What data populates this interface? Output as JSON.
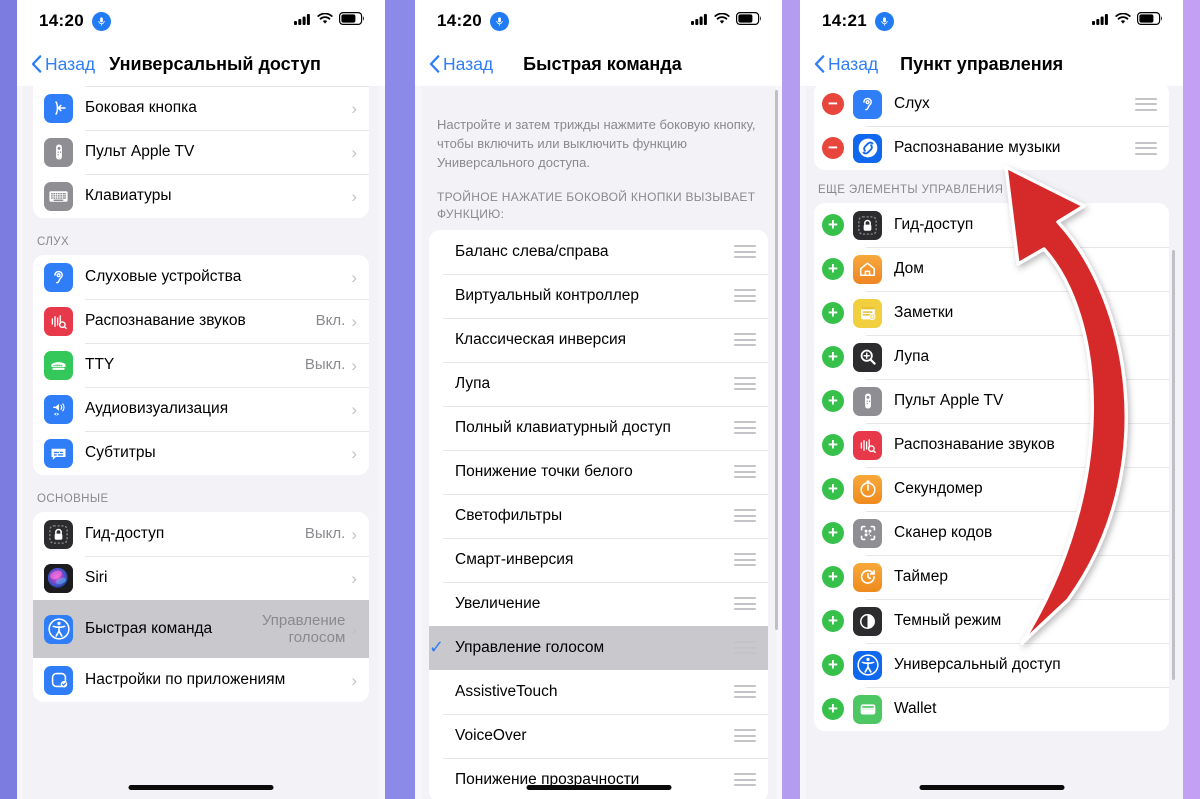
{
  "panel1": {
    "status": {
      "time": "14:20",
      "mic_icon": "microphone-icon",
      "signal_icon": "cellular-signal-icon",
      "wifi_icon": "wifi-icon",
      "battery_icon": "battery-icon"
    },
    "nav": {
      "back_label": "Назад",
      "title": "Универсальный доступ"
    },
    "sections": [
      {
        "header": "",
        "rows": [
          {
            "label": "Боковая кнопка",
            "value": "",
            "chevron": true,
            "icon": "side-button-icon",
            "icon_color": "#2f7ef7"
          },
          {
            "label": "Пульт Apple TV",
            "value": "",
            "chevron": true,
            "icon": "apple-tv-remote-icon",
            "icon_color": "#8e8e93"
          },
          {
            "label": "Клавиатуры",
            "value": "",
            "chevron": true,
            "icon": "keyboard-icon",
            "icon_color": "#8e8e93"
          }
        ]
      },
      {
        "header": "СЛУХ",
        "rows": [
          {
            "label": "Слуховые устройства",
            "value": "",
            "chevron": true,
            "icon": "ear-icon",
            "icon_color": "#2f7ef7"
          },
          {
            "label": "Распознавание звуков",
            "value": "Вкл.",
            "chevron": true,
            "icon": "sound-recognition-icon",
            "icon_color": "#e8394a"
          },
          {
            "label": "TTY",
            "value": "Выкл.",
            "chevron": true,
            "icon": "tty-icon",
            "icon_color": "#34c759"
          },
          {
            "label": "Аудиовизуализация",
            "value": "",
            "chevron": true,
            "icon": "audio-visual-icon",
            "icon_color": "#2f7ef7"
          },
          {
            "label": "Субтитры",
            "value": "",
            "chevron": true,
            "icon": "subtitles-icon",
            "icon_color": "#2f7ef7"
          }
        ]
      },
      {
        "header": "ОСНОВНЫЕ",
        "rows": [
          {
            "label": "Гид-доступ",
            "value": "Выкл.",
            "chevron": true,
            "icon": "guided-access-icon",
            "icon_color": "#2c2c2e"
          },
          {
            "label": "Siri",
            "value": "",
            "chevron": true,
            "icon": "siri-icon",
            "icon_color": "#1c1c1e"
          },
          {
            "label": "Быстрая команда",
            "value": "Управление голосом",
            "chevron": true,
            "selected": true,
            "icon": "accessibility-icon",
            "icon_color": "#2f7ef7"
          },
          {
            "label": "Настройки по приложениям",
            "value": "",
            "chevron": true,
            "icon": "per-app-settings-icon",
            "icon_color": "#2f7ef7"
          }
        ]
      }
    ]
  },
  "panel2": {
    "status": {
      "time": "14:20",
      "mic_icon": "microphone-icon",
      "signal_icon": "cellular-signal-icon",
      "wifi_icon": "wifi-icon",
      "battery_icon": "battery-icon"
    },
    "nav": {
      "back_label": "Назад",
      "title": "Быстрая команда"
    },
    "description": "Настройте и затем трижды нажмите боковую кнопку, чтобы включить или выключить функцию Универсального доступа.",
    "list_header": "ТРОЙНОЕ НАЖАТИЕ БОКОВОЙ КНОПКИ ВЫЗЫВАЕТ ФУНКЦИЮ:",
    "rows": [
      {
        "label": "Баланс слева/справа",
        "checked": false
      },
      {
        "label": "Виртуальный контроллер",
        "checked": false
      },
      {
        "label": "Классическая инверсия",
        "checked": false
      },
      {
        "label": "Лупа",
        "checked": false
      },
      {
        "label": "Полный клавиатурный доступ",
        "checked": false
      },
      {
        "label": "Понижение точки белого",
        "checked": false
      },
      {
        "label": "Светофильтры",
        "checked": false
      },
      {
        "label": "Смарт-инверсия",
        "checked": false
      },
      {
        "label": "Увеличение",
        "checked": false
      },
      {
        "label": "Управление голосом",
        "checked": true
      },
      {
        "label": "AssistiveTouch",
        "checked": false
      },
      {
        "label": "VoiceOver",
        "checked": false
      },
      {
        "label": "Понижение прозрачности",
        "checked": false
      }
    ]
  },
  "panel3": {
    "status": {
      "time": "14:21",
      "mic_icon": "microphone-icon",
      "signal_icon": "cellular-signal-icon",
      "wifi_icon": "wifi-icon",
      "battery_icon": "battery-icon"
    },
    "nav": {
      "back_label": "Назад",
      "title": "Пункт управления"
    },
    "included_rows": [
      {
        "label": "Слух",
        "action": "remove",
        "icon": "ear-icon",
        "icon_color": "#2f7ef7"
      },
      {
        "label": "Распознавание музыки",
        "action": "remove",
        "icon": "shazam-icon",
        "icon_color": "#1068ef"
      }
    ],
    "more_header": "ЕЩЕ ЭЛЕМЕНТЫ УПРАВЛЕНИЯ",
    "more_rows": [
      {
        "label": "Гид-доступ",
        "action": "add",
        "icon": "guided-access-icon",
        "icon_color": "#2c2c2e"
      },
      {
        "label": "Дом",
        "action": "add",
        "icon": "home-icon",
        "icon_color": "#f0932f"
      },
      {
        "label": "Заметки",
        "action": "add",
        "icon": "notes-icon",
        "icon_color": "#f2cf3f"
      },
      {
        "label": "Лупа",
        "action": "add",
        "icon": "magnifier-icon",
        "icon_color": "#2c2c2e"
      },
      {
        "label": "Пульт Apple TV",
        "action": "add",
        "icon": "apple-tv-remote-icon",
        "icon_color": "#8e8e93"
      },
      {
        "label": "Распознавание звуков",
        "action": "add",
        "icon": "sound-recognition-icon",
        "icon_color": "#e8394a"
      },
      {
        "label": "Секундомер",
        "action": "add",
        "icon": "stopwatch-icon",
        "icon_color": "#f0932f"
      },
      {
        "label": "Сканер кодов",
        "action": "add",
        "icon": "code-scanner-icon",
        "icon_color": "#8e8e93"
      },
      {
        "label": "Таймер",
        "action": "add",
        "icon": "timer-icon",
        "icon_color": "#f0932f"
      },
      {
        "label": "Темный режим",
        "action": "add",
        "icon": "dark-mode-icon",
        "icon_color": "#2c2c2e"
      },
      {
        "label": "Универсальный доступ",
        "action": "add",
        "icon": "accessibility-icon",
        "icon_color": "#1068ef"
      },
      {
        "label": "Wallet",
        "action": "add",
        "icon": "wallet-icon",
        "icon_color": "#4cc764"
      }
    ],
    "annotation": {
      "type": "curved-arrow",
      "color": "#d62c2c",
      "direction": "up-left"
    }
  },
  "colors": {
    "accent": "#2f7ef7",
    "add": "#37c14b",
    "remove": "#e8453c",
    "annotation_red": "#d62c2c",
    "selected_row": "#c8c8cd"
  }
}
